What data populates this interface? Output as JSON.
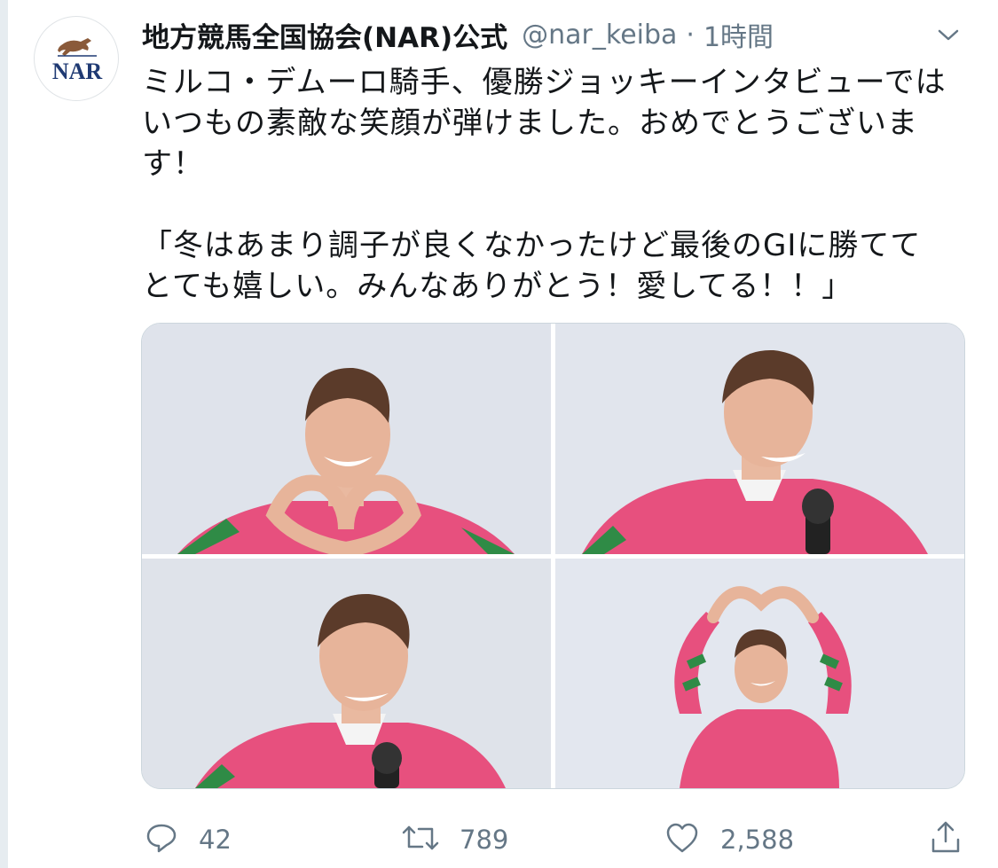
{
  "account": {
    "name": "地方競馬全国協会(NAR)公式",
    "handle": "@nar_keiba",
    "separator": "·",
    "time": "1時間",
    "avatar_text": "NAR"
  },
  "tweet": {
    "lines": [
      "ミルコ・デムーロ騎手、優勝ジョッキーインタビューでは",
      "いつもの素敵な笑顔が弾けました。おめでとうございま",
      "す！",
      "",
      "「冬はあまり調子が良くなかったけど最後のGIに勝てて",
      "とても嬉しい。みんなありがとう！愛してる！！」"
    ]
  },
  "actions": {
    "reply": {
      "icon": "reply-icon",
      "count": "42"
    },
    "retweet": {
      "icon": "retweet-icon",
      "count": "789"
    },
    "like": {
      "icon": "heart-icon",
      "count": "2,588"
    },
    "share": {
      "icon": "share-icon"
    }
  },
  "colors": {
    "text": "#14171a",
    "muted": "#657786",
    "border": "#ccd6dd",
    "silks_pink": "#e7507e",
    "silks_green": "#2f8b46",
    "nar_navy": "#1f3a73"
  }
}
